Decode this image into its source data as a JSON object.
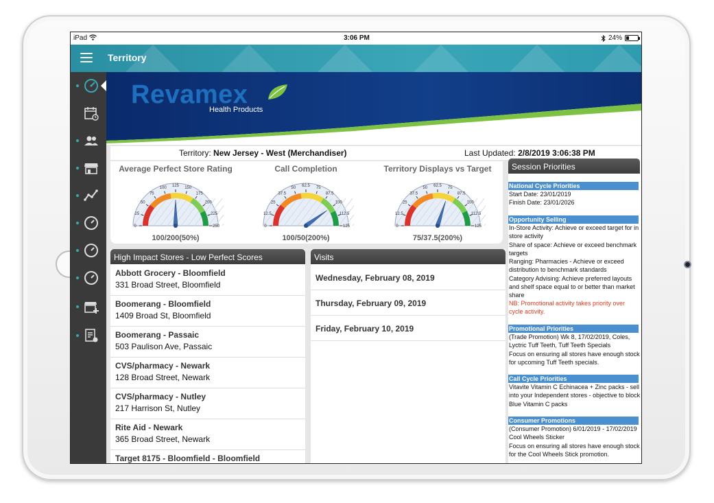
{
  "device": {
    "carrier": "iPad",
    "time": "3:06 PM",
    "battery": "24%"
  },
  "app": {
    "title": "Territory"
  },
  "sidebar": {
    "items": [
      {
        "icon": "dashboard-gauge-icon",
        "active": true
      },
      {
        "icon": "calendar-clock-icon"
      },
      {
        "icon": "users-icon"
      },
      {
        "icon": "store-icon"
      },
      {
        "icon": "trend-line-icon"
      },
      {
        "icon": "gauge-icon"
      },
      {
        "icon": "gauge-icon"
      },
      {
        "icon": "gauge-icon"
      },
      {
        "icon": "store-add-icon"
      },
      {
        "icon": "document-settings-icon"
      }
    ]
  },
  "brand": {
    "name": "Revamex",
    "tagline": "Health Products"
  },
  "info": {
    "territory_label": "Territory:",
    "territory_value": "New Jersey - West (Merchandiser)",
    "updated_label": "Last Updated:",
    "updated_value": "2/8/2019 3:06:38 PM"
  },
  "gauges": [
    {
      "title": "Average Perfect Store Rating",
      "value_text": "100/200(50%)",
      "fraction": 0.5,
      "ticks": [
        "0",
        "25",
        "50",
        "75",
        "100",
        "125",
        "150",
        "175",
        "200",
        "225",
        "250"
      ]
    },
    {
      "title": "Call Completion",
      "value_text": "100/50(200%)",
      "fraction": 0.8,
      "ticks": [
        "0",
        "12.5",
        "25",
        "37.5",
        "50",
        "62.5",
        "75",
        "87.5",
        "100",
        "112.5",
        "125"
      ]
    },
    {
      "title": "Territory Displays vs Target",
      "value_text": "75/37.5(200%)",
      "fraction": 0.6,
      "ticks": [
        "0",
        "12.5",
        "25",
        "37.5",
        "50",
        "62.5",
        "75",
        "87.5",
        "100",
        "112.5",
        "125"
      ]
    }
  ],
  "stores": {
    "header": "High Impact Stores - Low Perfect Scores",
    "items": [
      {
        "name": "Abbott Grocery - Bloomfield",
        "address": "331 Broad Street, Bloomfield"
      },
      {
        "name": "Boomerang - Bloomfield",
        "address": "1409 Broad St, Bloomfield"
      },
      {
        "name": "Boomerang - Passaic",
        "address": "503 Paulison Ave, Passaic"
      },
      {
        "name": "CVS/pharmacy - Newark",
        "address": "128 Broad Street, Newark"
      },
      {
        "name": "CVS/pharmacy - Nutley",
        "address": "217 Harrison St, Nutley"
      },
      {
        "name": "Rite Aid - Newark",
        "address": "365 Broad Street, Newark"
      },
      {
        "name": "Target 8175 - Bloomfield - Bloomfield",
        "address": ""
      }
    ]
  },
  "visits": {
    "header": "Visits",
    "items": [
      "Wednesday, February 08, 2019",
      "Thursday, February 09, 2019",
      "Friday, February 10, 2019"
    ]
  },
  "session": {
    "header": "Session Priorities",
    "national_head": "National Cycle Priorities",
    "national_lines": [
      "Start Date: 23/01/2019",
      "Finish Date: 23/01/2026"
    ],
    "opportunity_head": "Opportunity Selling",
    "opportunity_text": "In-Store Activity: Achieve or exceed target for in store activity\nShare of space: Achieve or exceed benchmark targets\nRanging: Pharmacies - Achieve or exceed distribution to benchmark standards\nCategory Advising: Achieve preferred layouts and shelf space equal to or better than market share",
    "opportunity_note": "NB: Promotional activity takes priority over cycle activity.",
    "promo_head": "Promotional Priorities",
    "promo_text": "(Trade Promotion) Wk 8, 17/02/2019, Coles, Lyctric Tuff Teeth, Tuff Teeth Specials\nFocus on ensuring all stores have enough stock for upcoming Tuff Teeth specials.",
    "callcycle_head": "Call Cycle Priorities",
    "callcycle_text": "Vitavite Vitamin C Echinacea + Zinc packs - sell into your Independent stores - objective to block Blue Vitamin C packs",
    "consumer_head": "Consumer Promotions",
    "consumer_text": "(Consumer Promotion) 6/01/2019 - 17/02/2019 Cool Wheels Sticker\nFocus on ensuring all stores have enough stock for the Cool Wheels Stick promotion."
  },
  "colors": {
    "teal": "#3aa6b8",
    "sidebar": "#3a3a3a",
    "brand_blue": "#1e6fbf",
    "brand_green": "#7dc242",
    "section_blue": "#4a8fcf",
    "note_red": "#e03a1e"
  }
}
